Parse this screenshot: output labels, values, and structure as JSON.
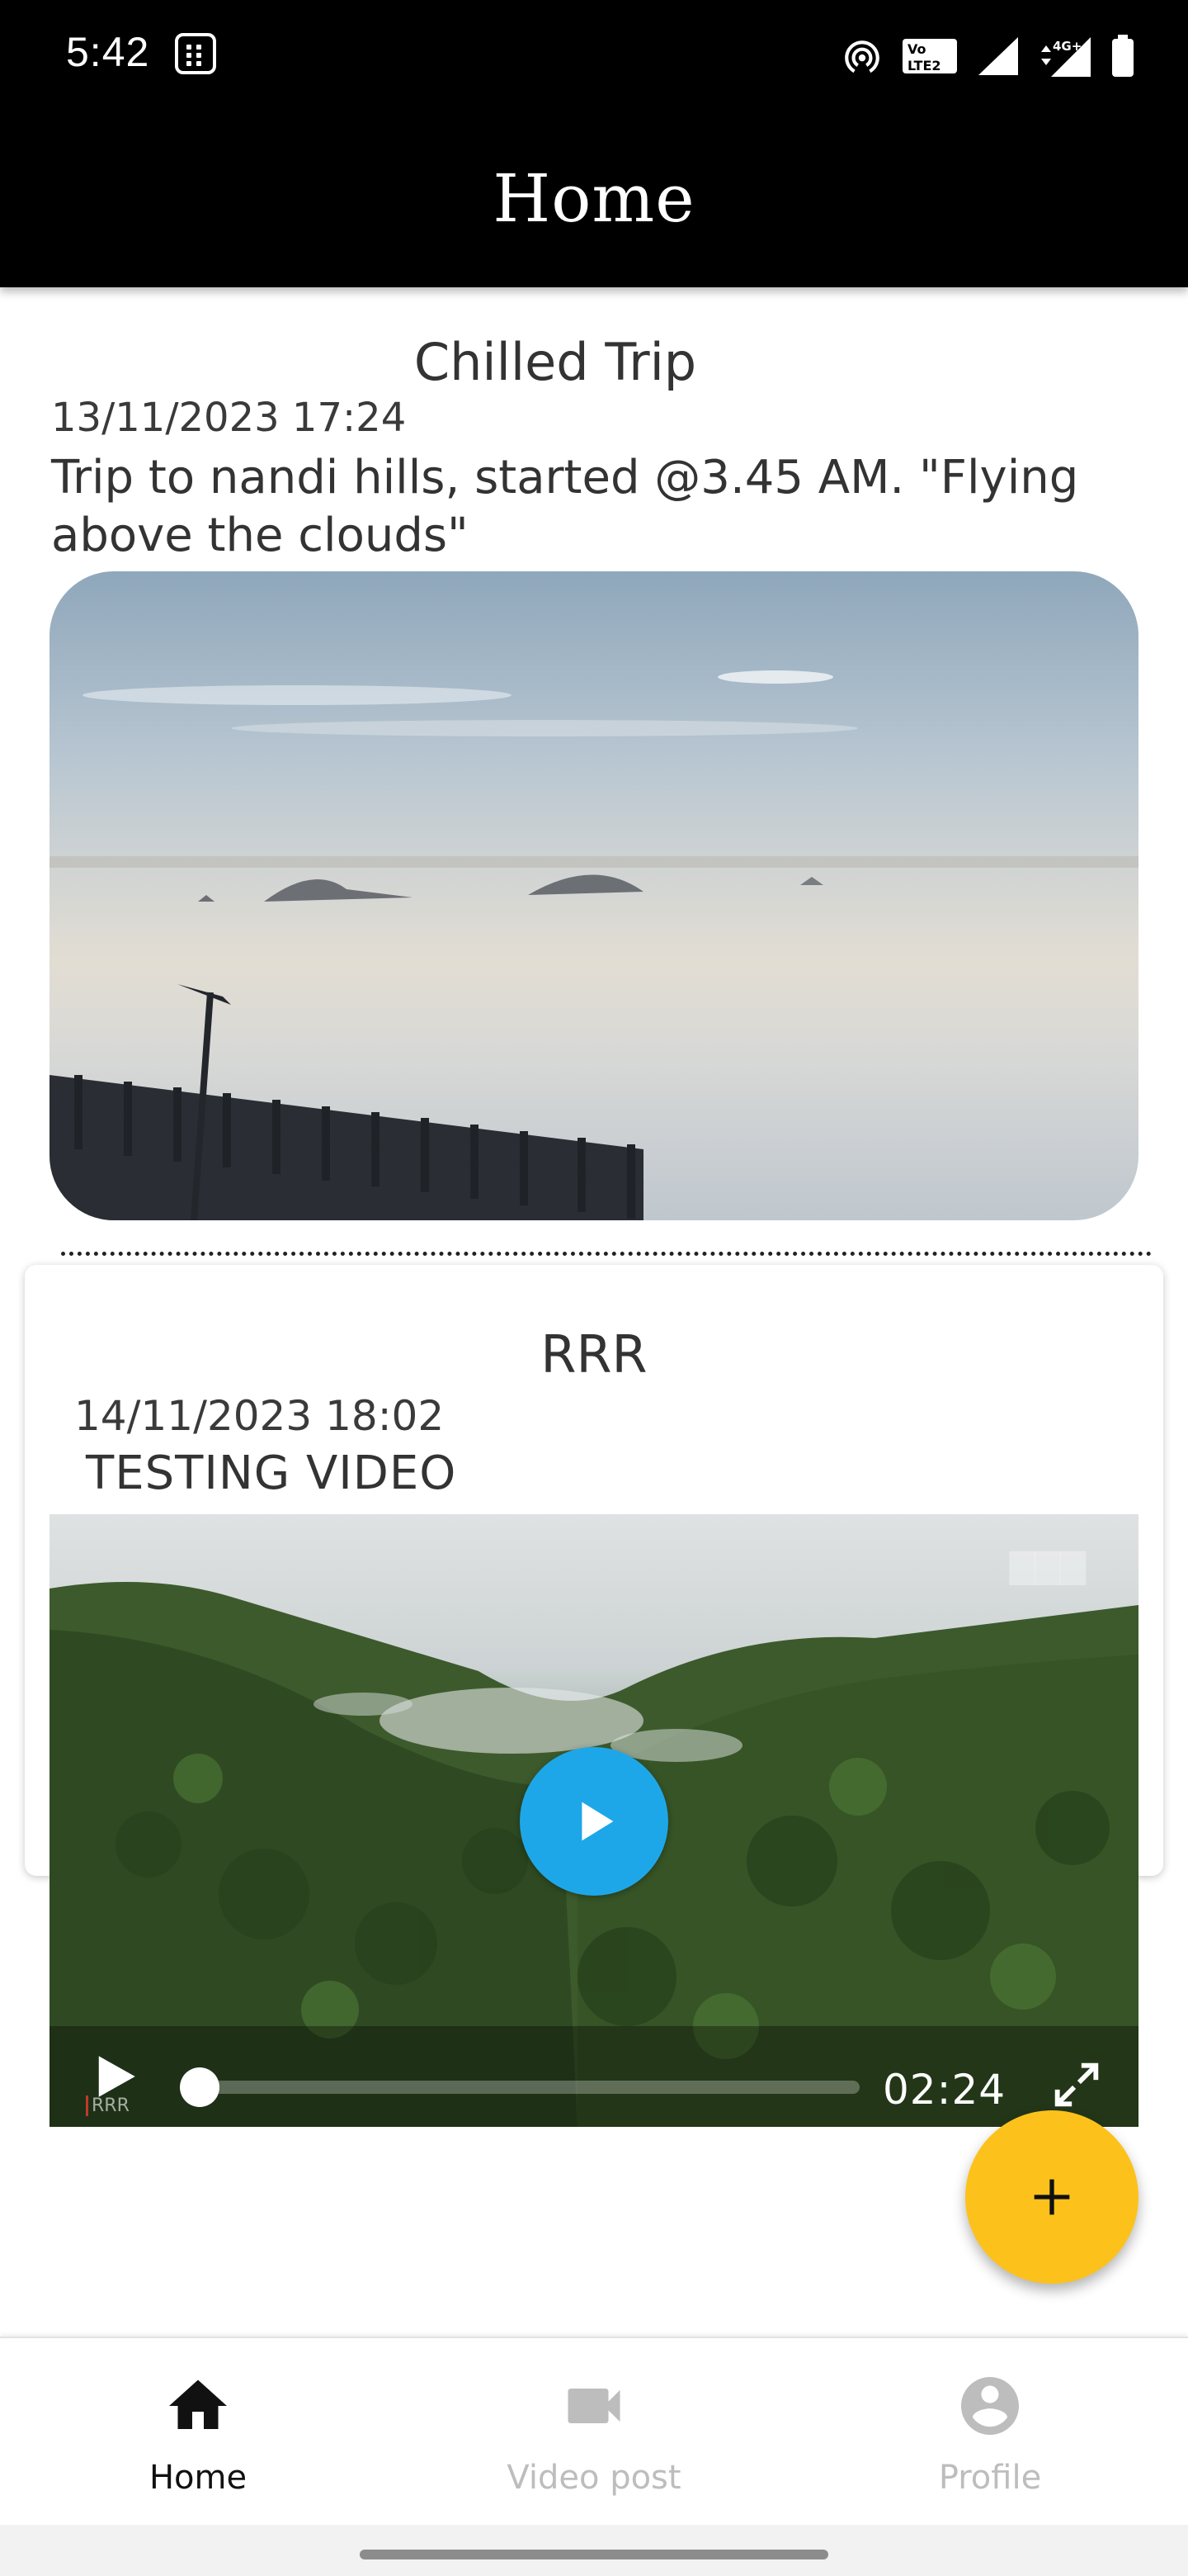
{
  "status_bar": {
    "time": "5:42",
    "icons": [
      "app-notification-icon",
      "hotspot-icon",
      "volte-icon",
      "signal-icon",
      "signal-4g-icon",
      "battery-icon"
    ],
    "volte_label": "Vo LTE 2",
    "network_label": "4G+"
  },
  "app_bar": {
    "title": "Home",
    "background": "#000000"
  },
  "posts": [
    {
      "title": "Chilled Trip",
      "date": "13/11/2023 17:24",
      "description": "Trip to nandi hills, started @3.45 AM. \"Flying above the clouds\"",
      "media": "image"
    },
    {
      "title": "RRR",
      "date": "14/11/2023 18:02",
      "description": "TESTING VIDEO",
      "media": "video",
      "video": {
        "duration": "02:24",
        "progress": 0,
        "watermark": "RRR"
      }
    }
  ],
  "fab": {
    "icon": "plus-icon",
    "color": "#fcc21b"
  },
  "bottom_nav": {
    "items": [
      {
        "label": "Home",
        "icon": "home-icon",
        "active": true
      },
      {
        "label": "Video post",
        "icon": "videocam-icon",
        "active": false
      },
      {
        "label": "Profile",
        "icon": "account-circle-icon",
        "active": false
      }
    ]
  }
}
